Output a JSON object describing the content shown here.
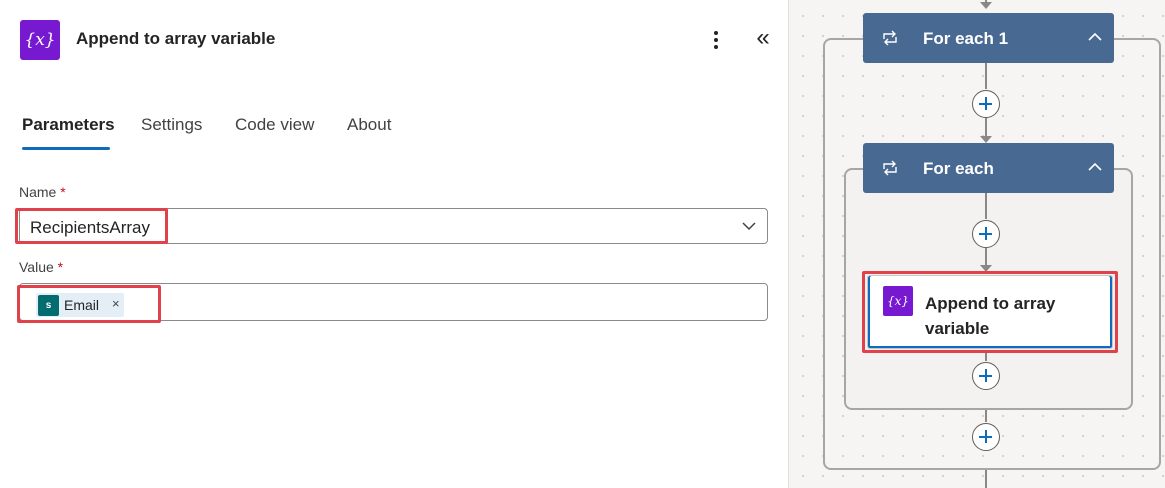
{
  "panel": {
    "icon_text": "{x}",
    "title": "Append to array variable",
    "more_icon": "more-vertical-icon",
    "collapse_icon": "double-chevron-left-icon",
    "collapse_glyph": "«"
  },
  "tabs": [
    {
      "label": "Parameters",
      "active": true
    },
    {
      "label": "Settings",
      "active": false
    },
    {
      "label": "Code view",
      "active": false
    },
    {
      "label": "About",
      "active": false
    }
  ],
  "form": {
    "name_label": "Name",
    "name_value": "RecipientsArray",
    "value_label": "Value",
    "required_mark": "*",
    "token": {
      "icon_text": "s",
      "label": "Email",
      "remove": "×"
    }
  },
  "canvas": {
    "outer_loop_title": "For each 1",
    "inner_loop_title": "For each",
    "action_icon_text": "{x}",
    "action_title": "Append to array variable"
  },
  "colors": {
    "variable_purple": "#7719d1",
    "loop_blue": "#486991",
    "highlight_red": "#e0424b",
    "tab_underline": "#0f6cbd",
    "sharepoint_teal": "#036c70"
  }
}
